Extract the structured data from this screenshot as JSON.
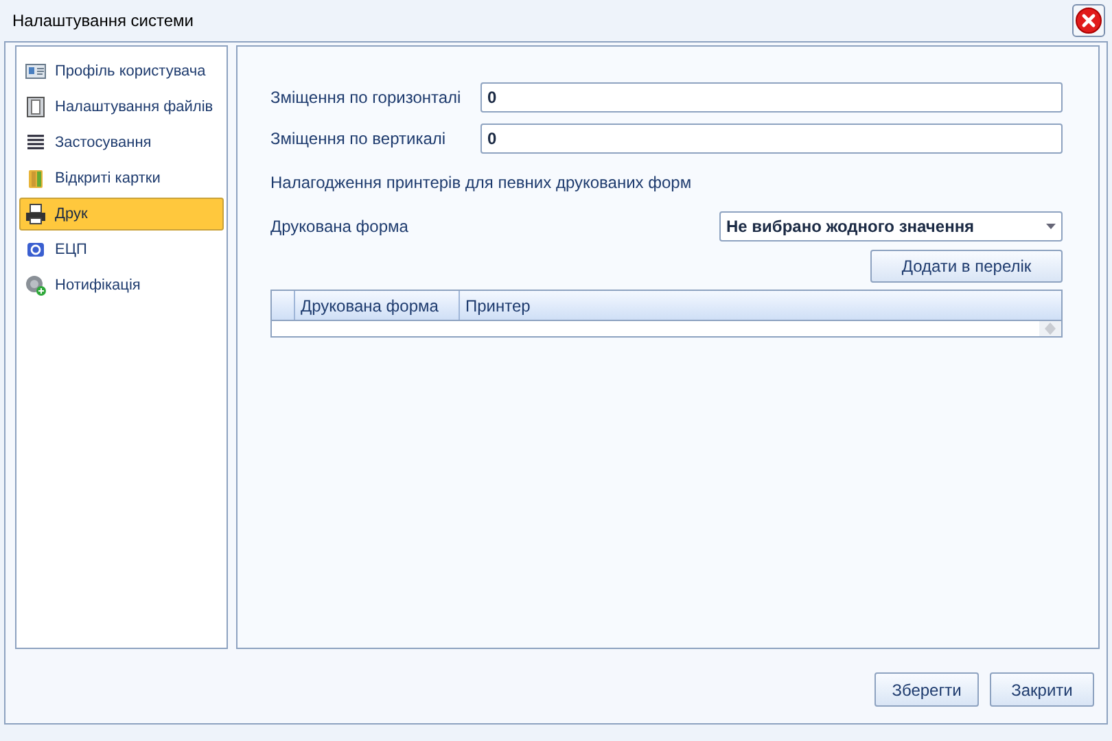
{
  "window": {
    "title": "Налаштування системи"
  },
  "sidebar": {
    "items": [
      {
        "label": "Профіль користувача",
        "selected": false
      },
      {
        "label": "Налаштування файлів",
        "selected": false
      },
      {
        "label": "Застосування",
        "selected": false
      },
      {
        "label": "Відкриті картки",
        "selected": false
      },
      {
        "label": "Друк",
        "selected": true
      },
      {
        "label": "ЕЦП",
        "selected": false
      },
      {
        "label": "Нотифікація",
        "selected": false
      }
    ]
  },
  "fields": [
    {
      "label": "Зміщення по горизонталі",
      "value": "0"
    },
    {
      "label": "Зміщення по вертикалі",
      "value": "0"
    }
  ],
  "section_title": "Налагодження принтерів для певних друкованих форм",
  "form_select": {
    "label": "Друкована форма",
    "value": "Не вибрано жодного значення"
  },
  "add_button": "Додати в перелік",
  "table": {
    "columns": [
      "Друкована форма",
      "Принтер"
    ]
  },
  "buttons": [
    "Зберегти",
    "Закрити"
  ]
}
